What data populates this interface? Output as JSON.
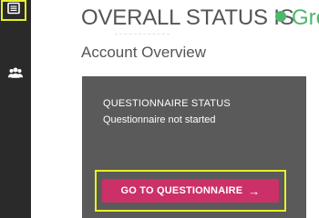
{
  "sidebar": {
    "items": [
      {
        "name": "dashboard",
        "icon": "list-icon",
        "selected": true
      },
      {
        "name": "users",
        "icon": "users-icon",
        "selected": false
      }
    ]
  },
  "header": {
    "status_label": "OVERALL STATUS IS",
    "status_value": "Gre",
    "status_color": "#4cb86b"
  },
  "section": {
    "title": "Account Overview"
  },
  "card": {
    "title": "QUESTIONNAIRE STATUS",
    "status_text": "Questionnaire not started",
    "button_label": "GO TO QUESTIONNAIRE",
    "button_arrow": "→"
  },
  "colors": {
    "sidebar": "#2a2a2a",
    "card": "#5a5a5a",
    "button": "#cc3068",
    "highlight": "#e8ef2a"
  }
}
